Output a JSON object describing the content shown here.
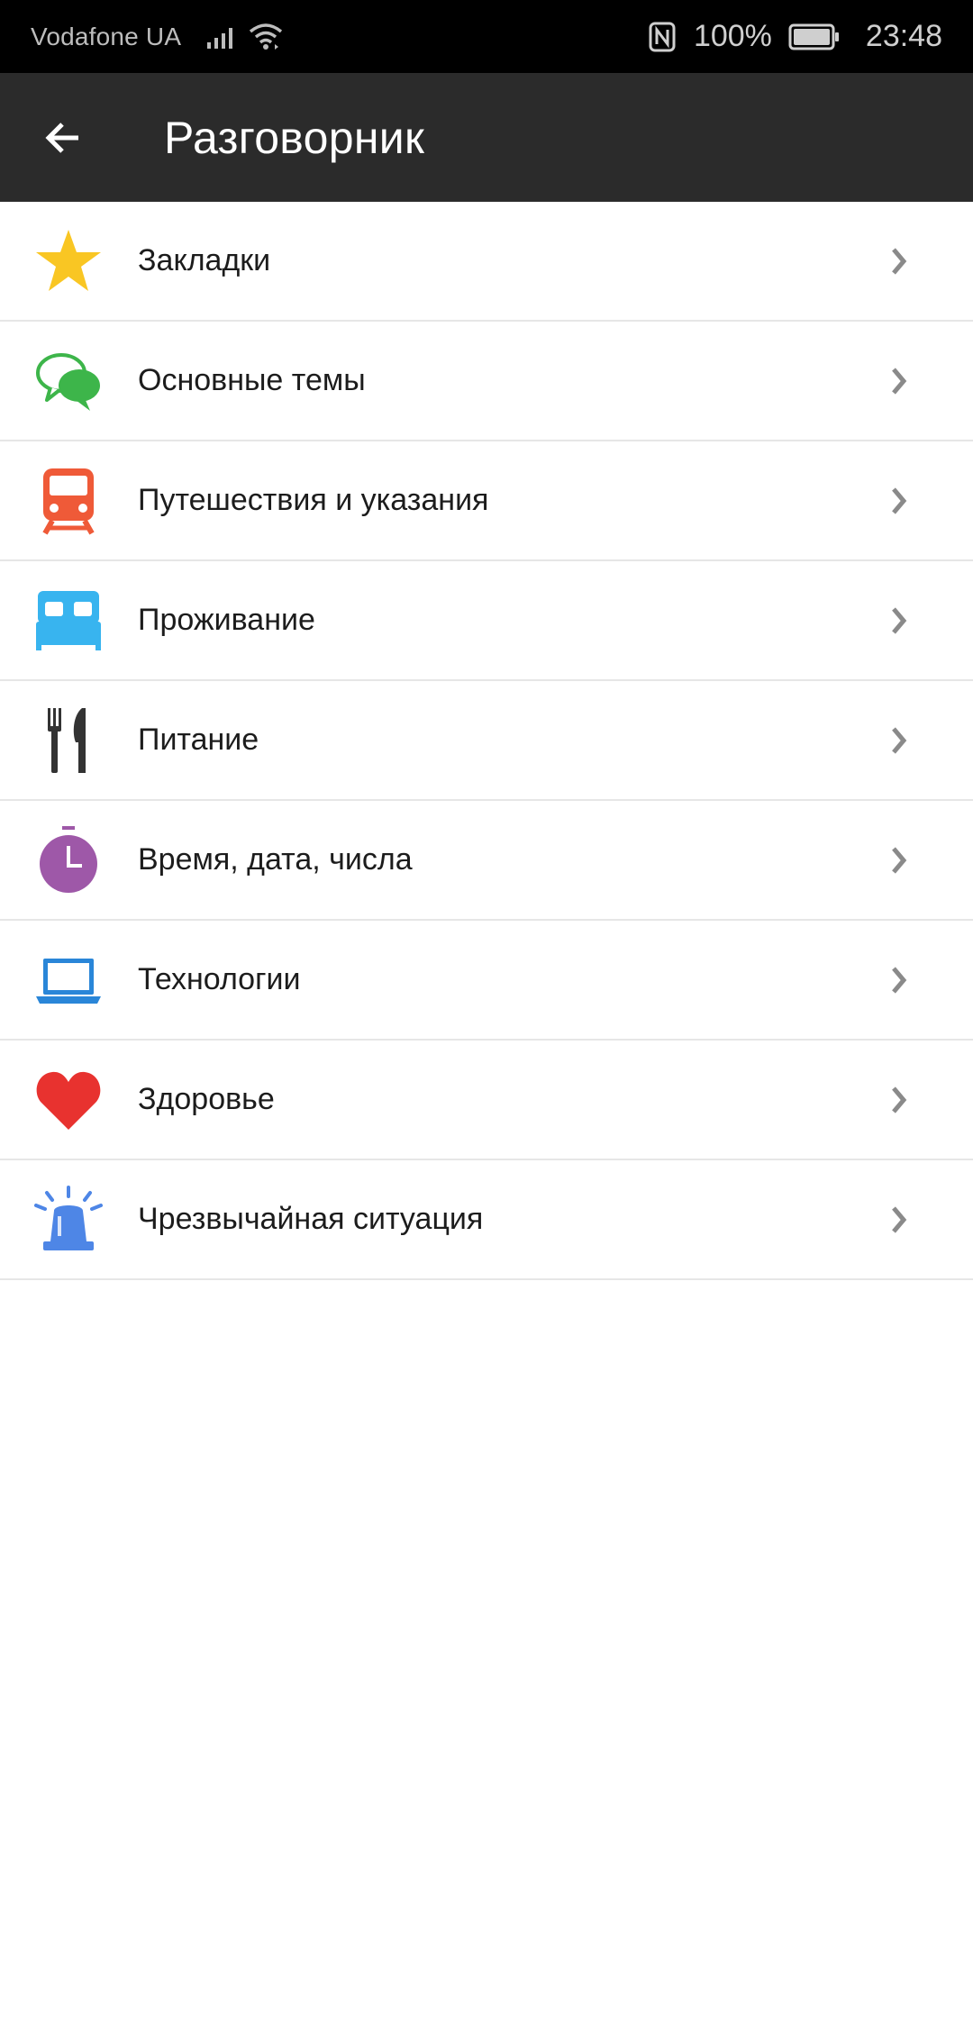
{
  "status_bar": {
    "carrier": "Vodafone UA",
    "battery_percent": "100%",
    "time": "23:48",
    "icons": [
      "signal-icon",
      "wifi-icon",
      "nfc-icon",
      "battery-icon"
    ]
  },
  "app_bar": {
    "title": "Разговорник",
    "back_icon": "arrow-left-icon"
  },
  "categories": [
    {
      "label": "Закладки",
      "icon": "star-icon",
      "color": "#F9C623"
    },
    {
      "label": "Основные темы",
      "icon": "speech-bubbles-icon",
      "color": "#3DB54A"
    },
    {
      "label": "Путешествия и указания",
      "icon": "train-icon",
      "color": "#EF5A38"
    },
    {
      "label": "Проживание",
      "icon": "bed-icon",
      "color": "#38B4EF"
    },
    {
      "label": "Питание",
      "icon": "cutlery-icon",
      "color": "#333333"
    },
    {
      "label": "Время, дата, числа",
      "icon": "stopwatch-icon",
      "color": "#9E58A8"
    },
    {
      "label": "Технологии",
      "icon": "laptop-icon",
      "color": "#2A86D8"
    },
    {
      "label": "Здоровье",
      "icon": "heart-icon",
      "color": "#E8322F"
    },
    {
      "label": "Чрезвычайная ситуация",
      "icon": "siren-icon",
      "color": "#4E86E6"
    }
  ],
  "chevron_icon": "chevron-right-icon",
  "colors": {
    "status_bar_bg": "#000000",
    "app_bar_bg": "#2B2B2B",
    "divider": "#E6E6E6",
    "chevron": "#8A8A8A"
  }
}
